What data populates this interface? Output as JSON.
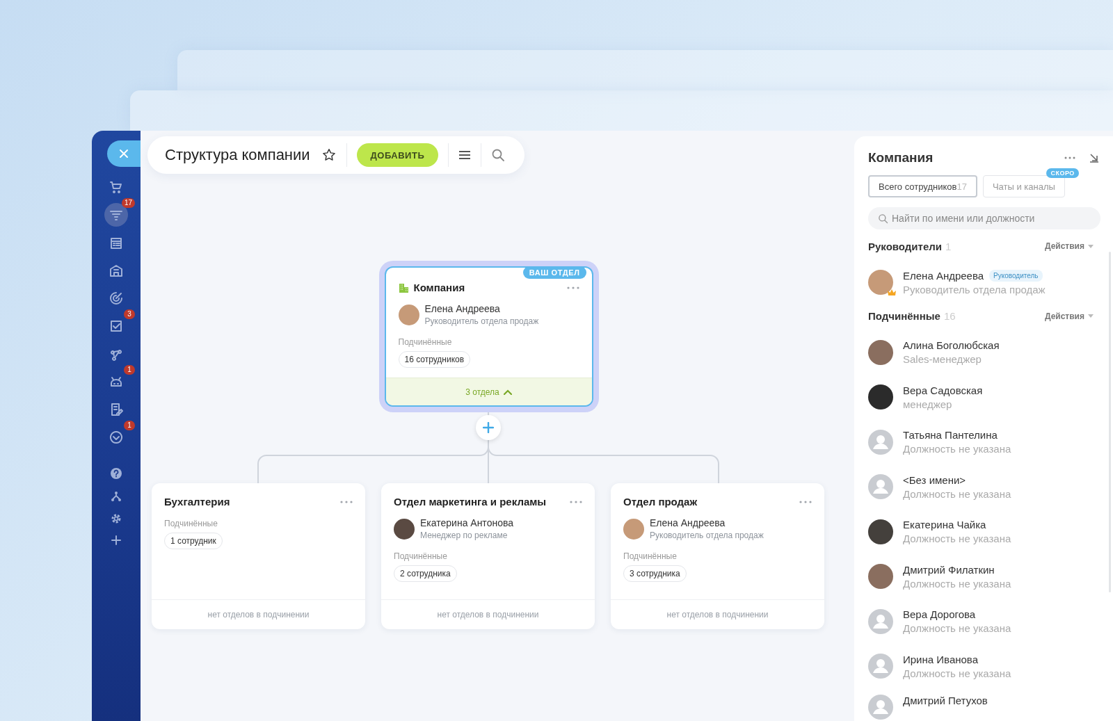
{
  "sidebar": {
    "items": [
      {
        "selected": false
      },
      {
        "badge": "17",
        "selected": true
      },
      {
        "selected": false
      },
      {
        "selected": false
      },
      {
        "selected": false
      },
      {
        "badge": "3",
        "selected": false
      },
      {
        "selected": false
      },
      {
        "badge": "1",
        "selected": false
      },
      {
        "selected": false
      },
      {
        "badge": "1",
        "selected": false
      }
    ]
  },
  "header": {
    "title": "Структура компании",
    "add_button": "ДОБАВИТЬ"
  },
  "org": {
    "root": {
      "title": "Компания",
      "badge": "ВАШ ОТДЕЛ",
      "head": {
        "name": "Елена Андреева",
        "role": "Руководитель отдела продаж"
      },
      "subordinates_label": "Подчинённые",
      "count": "16 сотрудников",
      "expander": "3 отдела",
      "expanded": true
    },
    "children": [
      {
        "title": "Бухгалтерия",
        "subordinates_label": "Подчинённые",
        "count": "1 сотрудник",
        "footer": "нет отделов в подчинении"
      },
      {
        "title": "Отдел маркетинга и рекламы",
        "head": {
          "name": "Екатерина Антонова",
          "role": "Менеджер по рекламе"
        },
        "subordinates_label": "Подчинённые",
        "count": "2 сотрудника",
        "footer": "нет отделов в подчинении"
      },
      {
        "title": "Отдел продаж",
        "head": {
          "name": "Елена Андреева",
          "role": "Руководитель отдела продаж"
        },
        "subordinates_label": "Подчинённые",
        "count": "3 сотрудника",
        "footer": "нет отделов в подчинении"
      }
    ]
  },
  "panel": {
    "title": "Компания",
    "tabs": [
      {
        "label": "Всего сотрудников",
        "count": "17",
        "selected": true
      },
      {
        "label": "Чаты и каналы",
        "selected": false,
        "badge": "СКОРО"
      }
    ],
    "search": {
      "placeholder": "Найти по имени или должности"
    },
    "sections": [
      {
        "title": "Руководители",
        "count": "1",
        "actions": "Действия",
        "people": [
          {
            "name": "Елена Андреева",
            "tag": "Руководитель",
            "role": "Руководитель отдела продаж",
            "kind": "photo",
            "leader": true
          }
        ]
      },
      {
        "title": "Подчинённые",
        "count": "16",
        "actions": "Действия",
        "people": [
          {
            "name": "Алина Боголюбская",
            "role": "Sales-менеджер",
            "kind": "photo",
            "leader": false
          },
          {
            "name": "Вера Садовская",
            "role": "менеджер",
            "kind": "photo",
            "leader": false
          },
          {
            "name": "Татьяна Пантелина",
            "role": "Должность не указана",
            "kind": "silhouette",
            "leader": false
          },
          {
            "name": "<Без имени>",
            "role": "Должность не указана",
            "kind": "silhouette",
            "leader": false
          },
          {
            "name": "Екатерина Чайка",
            "role": "Должность не указана",
            "kind": "photo",
            "leader": false
          },
          {
            "name": "Дмитрий Филаткин",
            "role": "Должность не указана",
            "kind": "photo",
            "leader": false
          },
          {
            "name": "Вера Дорогова",
            "role": "Должность не указана",
            "kind": "silhouette",
            "leader": false
          },
          {
            "name": "Ирина Иванова",
            "role": "Должность не указана",
            "kind": "silhouette",
            "leader": false
          },
          {
            "name": "Дмитрий Петухов",
            "kind": "silhouette",
            "leader": false
          }
        ]
      }
    ]
  }
}
